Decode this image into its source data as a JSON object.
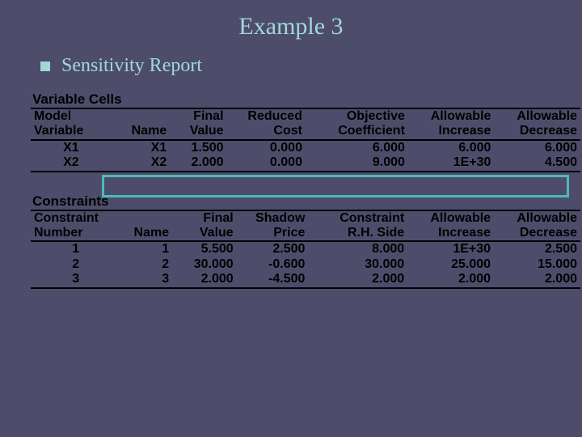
{
  "title": "Example 3",
  "subtitle": "Sensitivity Report",
  "variable_cells": {
    "section_label": "Variable Cells",
    "headers": {
      "col1a": "Model",
      "col1b": "Variable",
      "col2a": "",
      "col2b": "Name",
      "col3a": "Final",
      "col3b": "Value",
      "col4a": "Reduced",
      "col4b": "Cost",
      "col5a": "Objective",
      "col5b": "Coefficient",
      "col6a": "Allowable",
      "col6b": "Increase",
      "col7a": "Allowable",
      "col7b": "Decrease"
    },
    "rows": [
      {
        "id": "X1",
        "name": "X1",
        "final": "1.500",
        "reduced": "0.000",
        "obj": "6.000",
        "inc": "6.000",
        "dec": "6.000"
      },
      {
        "id": "X2",
        "name": "X2",
        "final": "2.000",
        "reduced": "0.000",
        "obj": "9.000",
        "inc": "1E+30",
        "dec": "4.500"
      }
    ]
  },
  "constraints": {
    "section_label": "Constraints",
    "headers": {
      "col1a": "Constraint",
      "col1b": "Number",
      "col2a": "",
      "col2b": "Name",
      "col3a": "Final",
      "col3b": "Value",
      "col4a": "Shadow",
      "col4b": "Price",
      "col5a": "Constraint",
      "col5b": "R.H. Side",
      "col6a": "Allowable",
      "col6b": "Increase",
      "col7a": "Allowable",
      "col7b": "Decrease"
    },
    "rows": [
      {
        "id": "1",
        "name": "1",
        "final": "5.500",
        "shadow": "2.500",
        "rhs": "8.000",
        "inc": "1E+30",
        "dec": "2.500"
      },
      {
        "id": "2",
        "name": "2",
        "final": "30.000",
        "shadow": "-0.600",
        "rhs": "30.000",
        "inc": "25.000",
        "dec": "15.000"
      },
      {
        "id": "3",
        "name": "3",
        "final": "2.000",
        "shadow": "-4.500",
        "rhs": "2.000",
        "inc": "2.000",
        "dec": "2.000"
      }
    ]
  }
}
